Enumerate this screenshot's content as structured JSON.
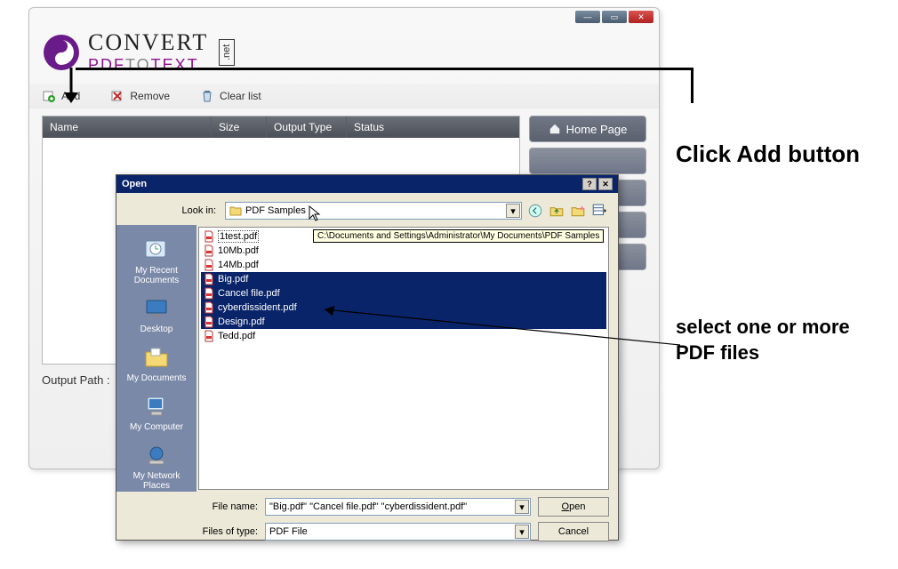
{
  "brand": {
    "line1": "CONVERT",
    "line2_pdf": "PDF",
    "line2_to": "TO",
    "line2_text": "TEXT",
    "net": ".net"
  },
  "window_controls": {
    "min": "—",
    "max": "▭",
    "close": "✕"
  },
  "toolbar": {
    "add": "Add",
    "remove": "Remove",
    "clear": "Clear list"
  },
  "columns": {
    "name": "Name",
    "size": "Size",
    "output": "Output Type",
    "status": "Status"
  },
  "side": {
    "home": "Home Page"
  },
  "footer": {
    "output_path": "Output Path :"
  },
  "dialog": {
    "title": "Open",
    "help": "?",
    "close": "✕",
    "look_in": "Look in:",
    "folder": "PDF Samples",
    "tooltip": "C:\\Documents and Settings\\Administrator\\My Documents\\PDF Samples",
    "places": {
      "recent": "My Recent Documents",
      "desktop": "Desktop",
      "mydocs": "My Documents",
      "mycomp": "My Computer",
      "mynet": "My Network Places"
    },
    "files": [
      {
        "name": "1test.pdf",
        "selected": false,
        "outlined": true
      },
      {
        "name": "10Mb.pdf",
        "selected": false,
        "outlined": false
      },
      {
        "name": "14Mb.pdf",
        "selected": false,
        "outlined": false
      },
      {
        "name": "Big.pdf",
        "selected": true,
        "outlined": false
      },
      {
        "name": "Cancel file.pdf",
        "selected": true,
        "outlined": false
      },
      {
        "name": "cyberdissident.pdf",
        "selected": true,
        "outlined": false
      },
      {
        "name": "Design.pdf",
        "selected": true,
        "outlined": false
      },
      {
        "name": "Tedd.pdf",
        "selected": false,
        "outlined": false
      }
    ],
    "file_name_label": "File name:",
    "file_name_value": "\"Big.pdf\" \"Cancel file.pdf\" \"cyberdissident.pdf\"",
    "file_type_label": "Files of type:",
    "file_type_value": "PDF File",
    "open_btn": "Open",
    "cancel_btn": "Cancel"
  },
  "callouts": {
    "c1": "Click Add button",
    "c2": "select one or more PDF files"
  }
}
